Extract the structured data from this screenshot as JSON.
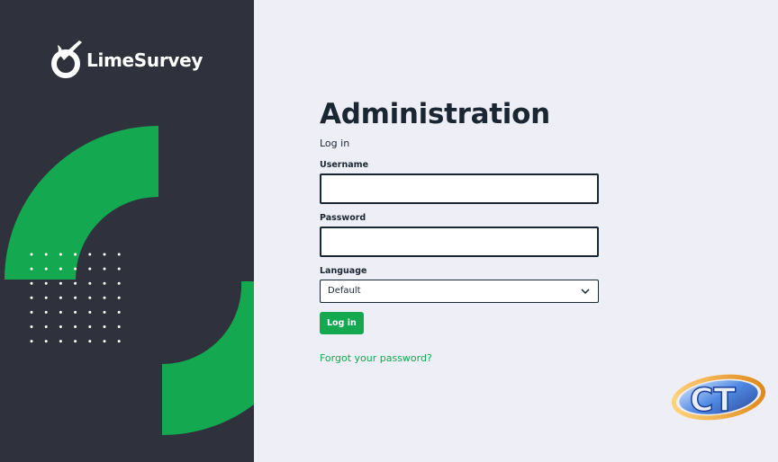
{
  "sidebar": {
    "brand": "LimeSurvey",
    "colors": {
      "background": "#2f323c",
      "accent": "#14a850"
    }
  },
  "main": {
    "title": "Administration",
    "subtitle": "Log in",
    "username": {
      "label": "Username",
      "value": ""
    },
    "password": {
      "label": "Password",
      "value": ""
    },
    "language": {
      "label": "Language",
      "selected": "Default"
    },
    "login_button": "Log in",
    "forgot_link": "Forgot your password?",
    "colors": {
      "background": "#eeeff6",
      "text": "#1b2633",
      "link": "#14a850"
    }
  },
  "icons": [
    "limesurvey-logo-icon",
    "chevron-down-icon",
    "ct-watermark-logo"
  ]
}
